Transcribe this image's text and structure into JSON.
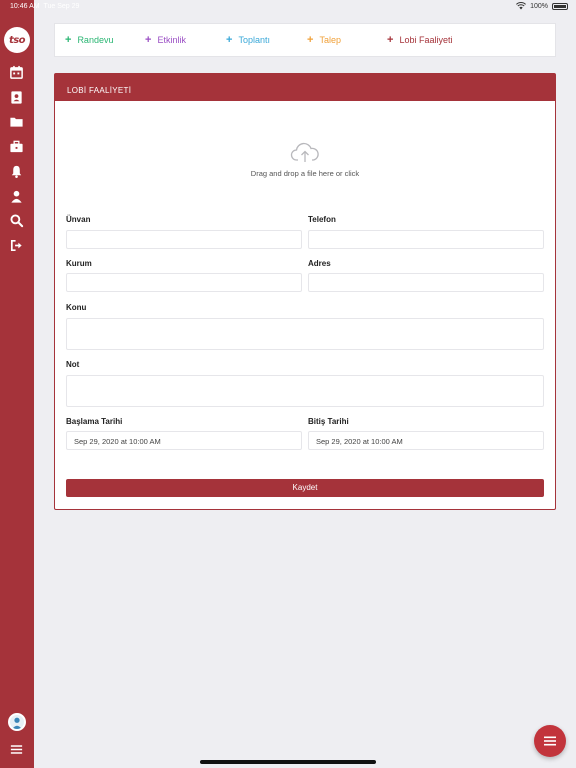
{
  "status_bar": {
    "time": "10:46 AM",
    "date": "Tue Sep 29",
    "battery": "100%"
  },
  "sidebar": {
    "logo_text": "tso",
    "icons": [
      "calendar-icon",
      "contact-card-icon",
      "folder-icon",
      "briefcase-icon",
      "bell-icon",
      "user-icon",
      "search-icon",
      "logout-icon"
    ],
    "bottom_icons": [
      "avatar",
      "menu-icon"
    ]
  },
  "tabs": [
    {
      "label": "Randevu",
      "color": "#2ab673"
    },
    {
      "label": "Etkinlik",
      "color": "#9b4fc4"
    },
    {
      "label": "Toplantı",
      "color": "#3aa8d8"
    },
    {
      "label": "Talep",
      "color": "#f0a13a"
    },
    {
      "label": "Lobi Faaliyeti",
      "color": "#a5333a"
    }
  ],
  "card": {
    "title": "LOBİ FAALİYETİ",
    "upload_text": "Drag and drop a file here or click",
    "fields": {
      "unvan": {
        "label": "Ünvan",
        "value": ""
      },
      "telefon": {
        "label": "Telefon",
        "value": ""
      },
      "kurum": {
        "label": "Kurum",
        "value": ""
      },
      "adres": {
        "label": "Adres",
        "value": ""
      },
      "konu": {
        "label": "Konu",
        "value": ""
      },
      "not": {
        "label": "Not",
        "value": ""
      },
      "baslama": {
        "label": "Başlama Tarihi",
        "value": "Sep 29, 2020 at 10:00 AM"
      },
      "bitis": {
        "label": "Bitiş Tarihi",
        "value": "Sep 29, 2020 at 10:00 AM"
      }
    },
    "save_label": "Kaydet"
  },
  "colors": {
    "brand": "#a5333a",
    "fab": "#c2343c",
    "background": "#eeeef2"
  }
}
